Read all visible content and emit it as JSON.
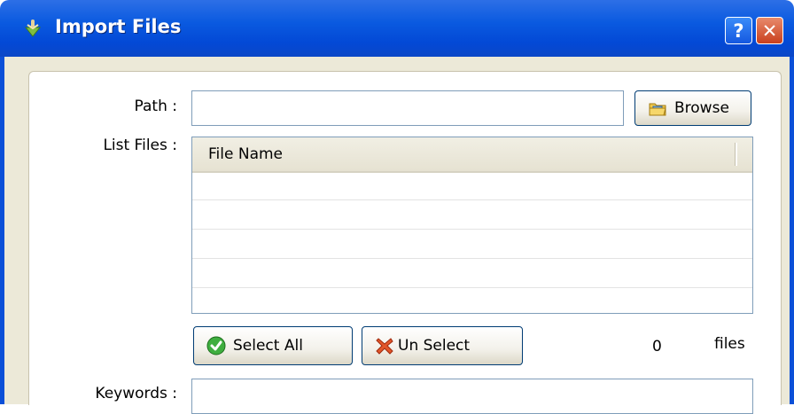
{
  "window": {
    "title": "Import Files",
    "help_label": "?",
    "close_label": "✕"
  },
  "form": {
    "path_label": "Path :",
    "path_value": "",
    "browse_label": "Browse",
    "list_files_label": "List Files :",
    "list_columns": [
      "File Name"
    ],
    "list_rows": [],
    "select_all_label": "Select All",
    "unselect_label": "Un Select",
    "file_count": "0",
    "files_label": "files",
    "keywords_label": "Keywords :",
    "keywords_value": ""
  },
  "colors": {
    "titlebar": "#0a5ae0",
    "client_bg": "#ece9d8",
    "button_border": "#003c74"
  },
  "icons": [
    "import-icon",
    "help-icon",
    "close-icon",
    "folder-icon",
    "check-icon",
    "x-icon"
  ]
}
